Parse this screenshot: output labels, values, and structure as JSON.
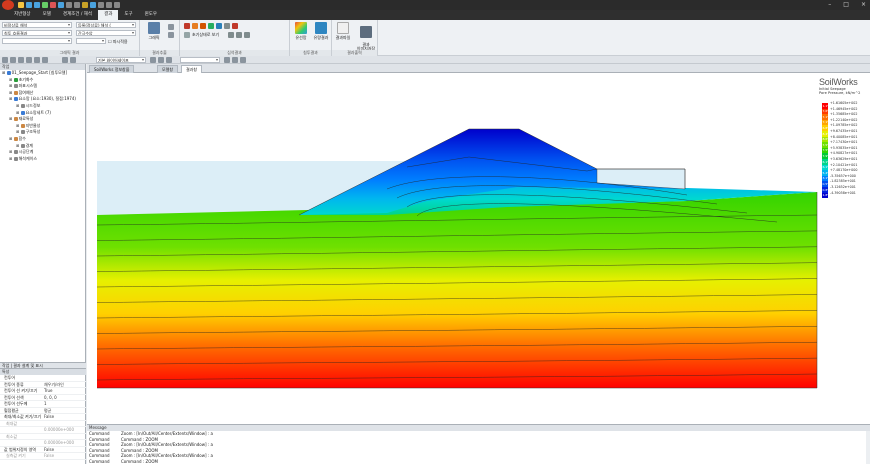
{
  "titlebar": {
    "qa_icon_colors": [
      "#f5c542",
      "#4aa3df",
      "#4aa3df",
      "#6c6",
      "#d55",
      "#4aa3df",
      "#888",
      "#888",
      "#c9a227",
      "#4aa3df",
      "#888",
      "#888",
      "#888"
    ]
  },
  "menu": [
    "지반형상",
    "모델",
    "경계조건 / 해석",
    "결과",
    "도구",
    "윈도우"
  ],
  "menu_active_index": 3,
  "ribbon": {
    "g1": {
      "combo1": "비정상류 해석",
      "combo2": "침투 흐름결과",
      "combo3": "",
      "combo4": "등록(정상류) 해석 (",
      "combo5": "간극수압",
      "combo6": "",
      "checkbox_label": "파시적용",
      "label": "그래픽 결과"
    },
    "g2": {
      "btn": "그래픽",
      "label": "결과추출"
    },
    "g3": {
      "btn": "초기상태로 보기",
      "label": "심석결과"
    },
    "g4": {
      "btn1": "유선망",
      "btn2": "유량결과",
      "label": "침투결과"
    },
    "g5": {
      "btn1": "결과파일",
      "btn2": "결과\n이미지저장",
      "label": "결과출력"
    }
  },
  "leftpanel": {
    "tree_title": "작업",
    "tree": [
      {
        "indent": 0,
        "label": "01_Seepage_Start [침투모델]",
        "color": "#3a7bd5"
      },
      {
        "indent": 1,
        "label": "초기화수",
        "color": "#2a9d3a"
      },
      {
        "indent": 1,
        "label": "좌표시스템",
        "color": "#888"
      },
      {
        "indent": 1,
        "label": "참여예산",
        "color": "#c84"
      },
      {
        "indent": 1,
        "label": "요소망 (요소:1930), 절점:1974)",
        "color": "#3a7bd5"
      },
      {
        "indent": 2,
        "label": "시드정보",
        "color": "#888"
      },
      {
        "indent": 2,
        "label": "요소망세트 (7)",
        "color": "#3a7bd5"
      },
      {
        "indent": 1,
        "label": "재료특성",
        "color": "#c84"
      },
      {
        "indent": 2,
        "label": "지반물성",
        "color": "#c84"
      },
      {
        "indent": 2,
        "label": "구조특성",
        "color": "#888"
      },
      {
        "indent": 1,
        "label": "함수",
        "color": "#c84"
      },
      {
        "indent": 2,
        "label": "경계",
        "color": "#888"
      },
      {
        "indent": 1,
        "label": "시공단계",
        "color": "#888"
      },
      {
        "indent": 1,
        "label": "해석케이스",
        "color": "#888"
      }
    ],
    "tabs_label": "작업 | 결과 설계 및 표시",
    "props_title": "특성",
    "props": [
      {
        "k": "컨투어",
        "v": "",
        "sub": false
      },
      {
        "k": "컨투어 종류",
        "v": "채우기/라인",
        "sub": false
      },
      {
        "k": "컨투어 선 켜기/끄기",
        "v": "True",
        "sub": false
      },
      {
        "k": "컨투어 선색",
        "v": "0, 0, 0",
        "sub": false
      },
      {
        "k": "컨투어 선두께",
        "v": "1",
        "sub": false
      },
      {
        "k": "혈점평균",
        "v": "평균",
        "sub": false
      },
      {
        "k": "최대/최소값 켜기/끄기",
        "v": "False",
        "sub": false
      },
      {
        "k": "최대값",
        "v": "",
        "sub": true
      },
      {
        "k": "",
        "v": "0.00000e+000",
        "sub": true
      },
      {
        "k": "최소값",
        "v": "",
        "sub": true
      },
      {
        "k": "",
        "v": "0.00000e+000",
        "sub": true
      },
      {
        "k": "값 범위지정의 영역",
        "v": "False",
        "sub": false
      },
      {
        "k": "실측값 켜기",
        "v": "False",
        "sub": true
      }
    ]
  },
  "doctabs": [
    "SoilWorks 정보창을",
    "모델창",
    "결과창"
  ],
  "doctab_active_index": 2,
  "legend": {
    "logo": "SoilWorks",
    "subtitle1": "Initial Seepage",
    "subtitle2": "Pore Pressure, kN/m^2",
    "rows": [
      {
        "pct": "1.1%",
        "val": "+1.61605e+002",
        "color": "#ff0000"
      },
      {
        "pct": "7.6%",
        "val": "+1.46945e+002",
        "color": "#ff3a00"
      },
      {
        "pct": "7.1%",
        "val": "+1.35685e+002",
        "color": "#ff7000"
      },
      {
        "pct": "7.1%",
        "val": "+1.22140e+002",
        "color": "#ffa500"
      },
      {
        "pct": "6.8%",
        "val": "+1.09785e+002",
        "color": "#ffd000"
      },
      {
        "pct": "8.4%",
        "val": "+9.67435e+001",
        "color": "#e6f000"
      },
      {
        "pct": "8.6%",
        "val": "+8.40085e+001",
        "color": "#a8e800"
      },
      {
        "pct": "7.5%",
        "val": "+7.17430e+001",
        "color": "#6ee000"
      },
      {
        "pct": "7.5%",
        "val": "+5.93835e+001",
        "color": "#33d400"
      },
      {
        "pct": "7.9%",
        "val": "+4.90827e+001",
        "color": "#00cc33"
      },
      {
        "pct": "6.1%",
        "val": "+3.63629e+001",
        "color": "#00d48a"
      },
      {
        "pct": "6.1%",
        "val": "+2.10421e+001",
        "color": "#00d8d0"
      },
      {
        "pct": "5.4%",
        "val": "+7.48170e+000",
        "color": "#00b4f0"
      },
      {
        "pct": "3.1%",
        "val": "-5.35657e+000",
        "color": "#0080ff"
      },
      {
        "pct": "0.5%",
        "val": "-1.82385e+001",
        "color": "#0050f0"
      },
      {
        "pct": "0.8%",
        "val": "-3.12652e+001",
        "color": "#0020e0"
      },
      {
        "pct": "1.8%",
        "val": "-4.39058e+001",
        "color": "#0000cc"
      }
    ]
  },
  "messages": {
    "title": "Message",
    "rows": [
      {
        "c1": "Command",
        "c2": "Zoom : [In/Out/All/Center/Extents/Window] : a"
      },
      {
        "c1": "Command",
        "c2": "Command : ZOOM"
      },
      {
        "c1": "Command",
        "c2": "Zoom : [In/Out/All/Center/Extents/Window] : a"
      },
      {
        "c1": "Command",
        "c2": "Command : ZOOM"
      },
      {
        "c1": "Command",
        "c2": "Zoom : [In/Out/All/Center/Extents/Window] : a"
      },
      {
        "c1": "Command",
        "c2": "Command : ZOOM"
      }
    ]
  }
}
